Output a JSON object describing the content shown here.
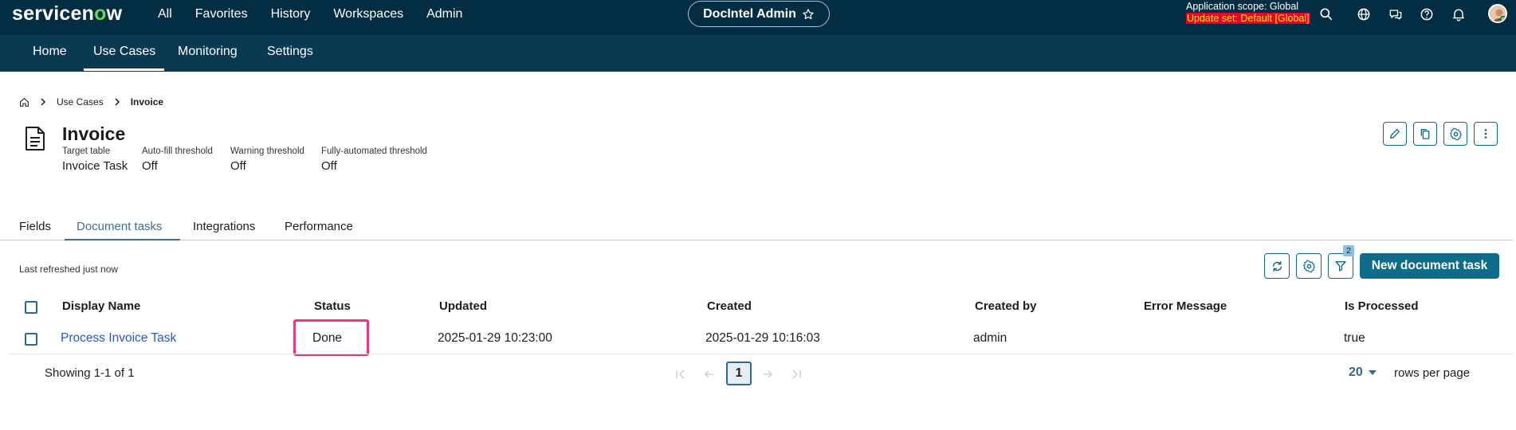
{
  "brand": {
    "logo_pre": "servicen",
    "logo_o": "o",
    "logo_post": "w"
  },
  "top_nav": [
    "All",
    "Favorites",
    "History",
    "Workspaces",
    "Admin"
  ],
  "workspace_pill": "DocIntel Admin",
  "scope": {
    "line1": "Application scope: Global",
    "line2": "Update set: Default [Global]"
  },
  "top_icons": [
    "search-icon",
    "globe-icon",
    "chat-icon",
    "help-icon",
    "bell-icon"
  ],
  "sub_nav": {
    "items": [
      "Home",
      "Use Cases",
      "Monitoring",
      "Settings"
    ],
    "active": "Use Cases"
  },
  "breadcrumb": {
    "home_icon": "home-icon",
    "items": [
      "Use Cases",
      "Invoice"
    ]
  },
  "record": {
    "icon": "document-icon",
    "title": "Invoice",
    "fields": [
      {
        "label": "Target table",
        "value": "Invoice Task"
      },
      {
        "label": "Auto-fill threshold",
        "value": "Off"
      },
      {
        "label": "Warning threshold",
        "value": "Off"
      },
      {
        "label": "Fully-automated threshold",
        "value": "Off"
      }
    ]
  },
  "header_actions": [
    "edit-icon",
    "copy-icon",
    "settings-icon",
    "more-icon"
  ],
  "tabs": {
    "items": [
      "Fields",
      "Document tasks",
      "Integrations",
      "Performance"
    ],
    "active": "Document tasks"
  },
  "list": {
    "refreshed": "Last refreshed just now",
    "filter_count": "2",
    "new_button": "New document task",
    "columns": [
      "Display Name",
      "Status",
      "Updated",
      "Created",
      "Created by",
      "Error Message",
      "Is Processed"
    ],
    "rows": [
      {
        "display_name": "Process Invoice Task",
        "status": "Done",
        "updated": "2025-01-29 10:23:00",
        "created": "2025-01-29 10:16:03",
        "created_by": "admin",
        "error_message": "",
        "is_processed": "true"
      }
    ]
  },
  "pagination": {
    "showing": "Showing 1-1 of 1",
    "current_page": "1",
    "rows_per_page_value": "20",
    "rows_per_page_label": "rows per page"
  },
  "colors": {
    "topbar": "#032d42",
    "subnav": "#0a3a52",
    "accent": "#0e6c8a",
    "link": "#2a56c6",
    "highlight": "#f0357c"
  }
}
